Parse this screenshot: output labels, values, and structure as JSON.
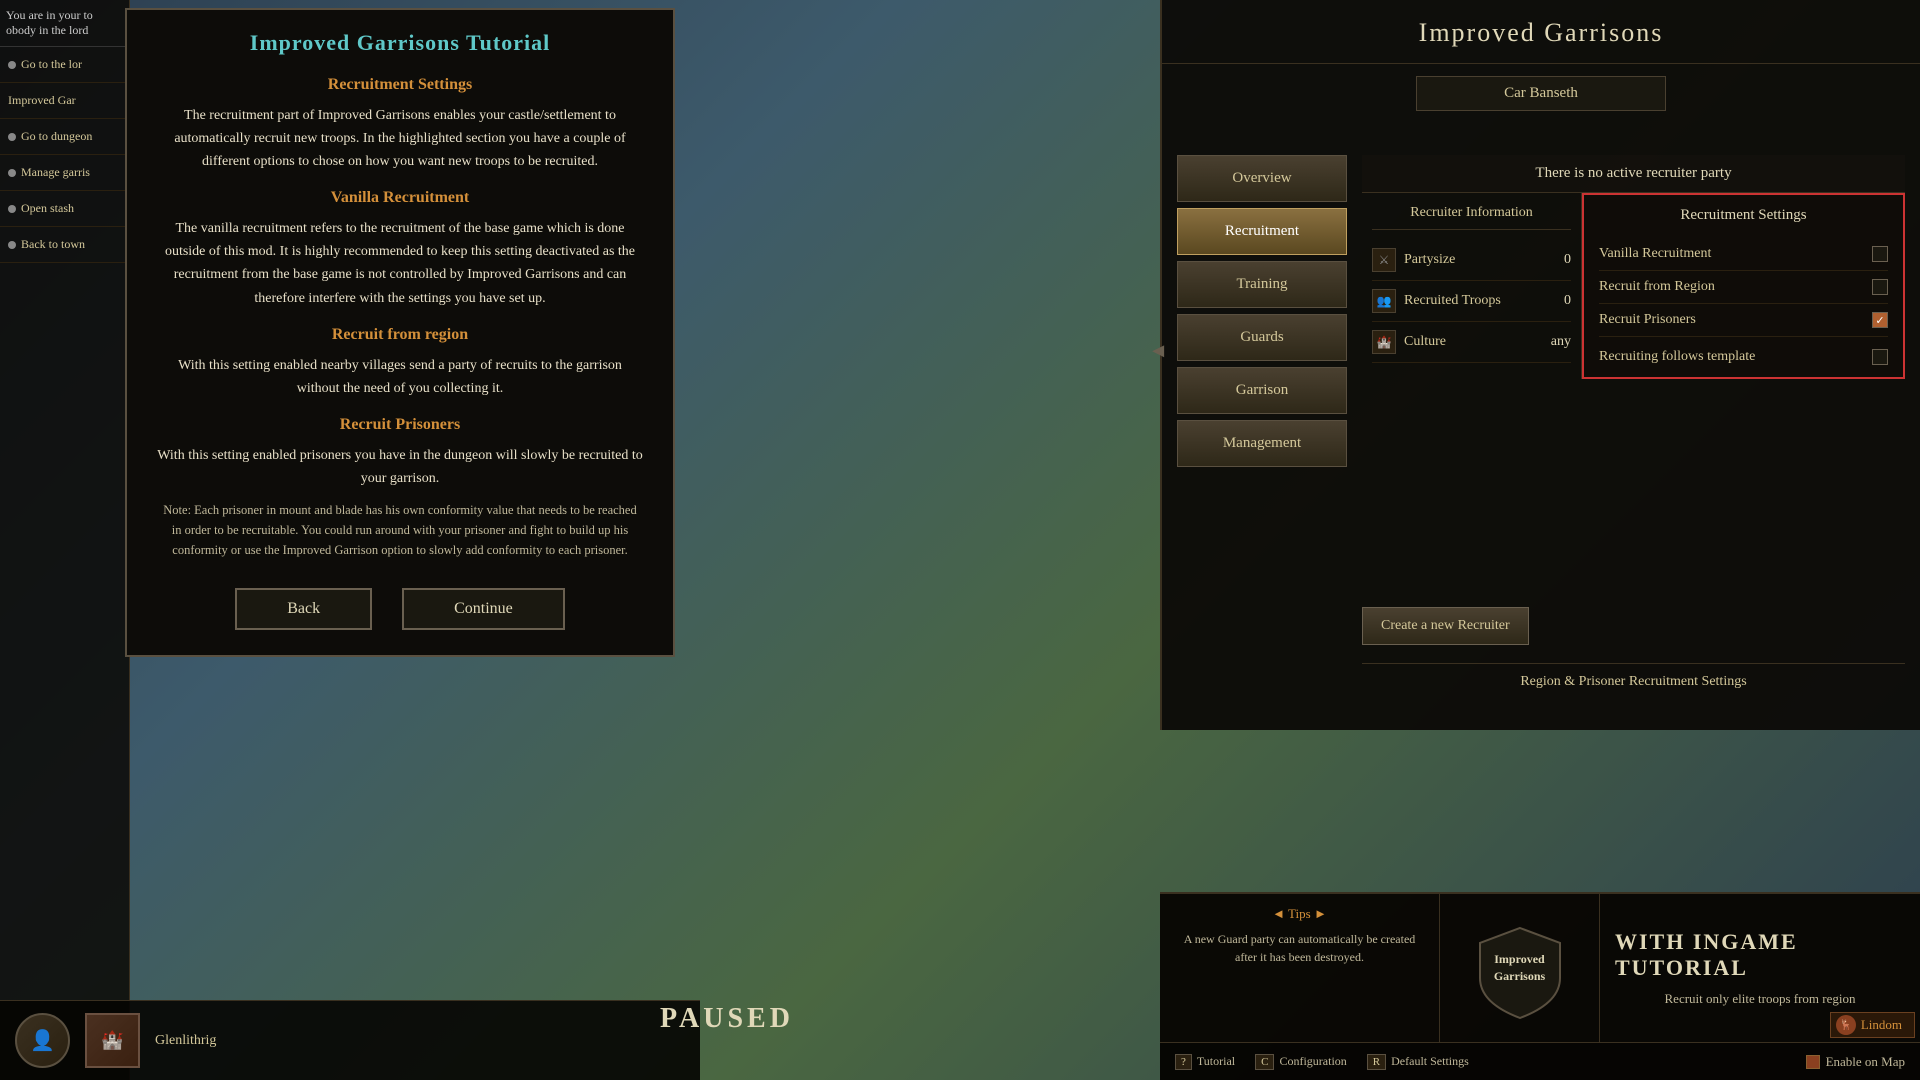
{
  "game": {
    "paused_label": "PAUSED"
  },
  "sidebar": {
    "intro_text_1": "You are in your to",
    "intro_text_2": "obody in the lord",
    "items": [
      {
        "label": "Go to the lor",
        "has_dot": true
      },
      {
        "label": "Improved Gar",
        "has_dot": false
      },
      {
        "label": "Go to dungeon",
        "has_dot": true
      },
      {
        "label": "Manage garris",
        "has_dot": true
      },
      {
        "label": "Open stash",
        "has_dot": true
      },
      {
        "label": "Back to town",
        "has_dot": true
      }
    ]
  },
  "tutorial_modal": {
    "title": "Improved Garrisons Tutorial",
    "section1_heading": "Recruitment Settings",
    "section1_text": "The recruitment part of Improved Garrisons enables your castle/settlement to automatically recruit new troops. In the highlighted section you have a couple of different options to chose on how you want new troops to be recruited.",
    "section2_heading": "Vanilla Recruitment",
    "section2_text": "The vanilla recruitment refers to the recruitment of the base game which is done outside of this mod. It is highly recommended to keep this setting deactivated as the recruitment from the base game is not controlled by Improved Garrisons and can therefore interfere with the settings you have set up.",
    "section3_heading": "Recruit from region",
    "section3_text": "With this setting enabled nearby villages send a party of recruits to the garrison without the need of you collecting it.",
    "section4_heading": "Recruit Prisoners",
    "section4_text": "With this setting enabled prisoners you have in the dungeon will slowly be recruited to your garrison.",
    "note_text": "Note: Each prisoner in mount and blade has his own conformity value that needs to be reached in order to be recruitable. You could run around with your prisoner and fight to build up his conformity or use the Improved Garrison option to slowly add conformity to each prisoner.",
    "back_button": "Back",
    "continue_button": "Continue"
  },
  "right_panel": {
    "title": "Improved Garrisons",
    "settlement": "Car Banseth",
    "nav": [
      {
        "label": "Overview",
        "active": false
      },
      {
        "label": "Recruitment",
        "active": true
      },
      {
        "label": "Training",
        "active": false
      },
      {
        "label": "Guards",
        "active": false
      },
      {
        "label": "Garrison",
        "active": false
      },
      {
        "label": "Management",
        "active": false
      }
    ],
    "recruiter_info_header": "There is no active recruiter party",
    "recruiter_info": {
      "title": "Recruiter Information",
      "party_size_label": "Partysize",
      "party_size_value": "0",
      "recruited_troops_label": "Recruited Troops",
      "recruited_troops_value": "0",
      "culture_label": "Culture",
      "culture_value": "any"
    },
    "recruitment_settings": {
      "title": "Recruitment Settings",
      "vanilla_label": "Vanilla Recruitment",
      "vanilla_checked": false,
      "region_label": "Recruit from Region",
      "region_checked": false,
      "prisoners_label": "Recruit Prisoners",
      "prisoners_checked": true,
      "follows_template_label": "Recruiting follows template",
      "follows_template_checked": false
    },
    "create_recruiter_btn": "Create a new Recruiter",
    "region_prisoner_label": "Region & Prisoner Recruitment Settings"
  },
  "bottom_section": {
    "tips_header": "◄ Tips ►",
    "tips_text": "A new Guard party can automatically be created after it has been destroyed.",
    "ig_logo_text_line1": "Improved",
    "ig_logo_text_line2": "Garrisons",
    "ingame_tutorial_label": "WITH INGAME TUTORIAL",
    "recruit_elite_text": "Recruit only elite troops from region"
  },
  "toolbar": {
    "tutorial_key": "?",
    "tutorial_label": "Tutorial",
    "configuration_key": "C",
    "configuration_label": "Configuration",
    "default_settings_key": "R",
    "default_settings_label": "Default Settings",
    "enable_on_map_label": "Enable on Map"
  },
  "bottom_bar": {
    "character_icon": "👤",
    "settlement_icon": "🏰",
    "settlement_name": "Glenlithrig"
  },
  "lindom": {
    "label": "Lindom"
  }
}
